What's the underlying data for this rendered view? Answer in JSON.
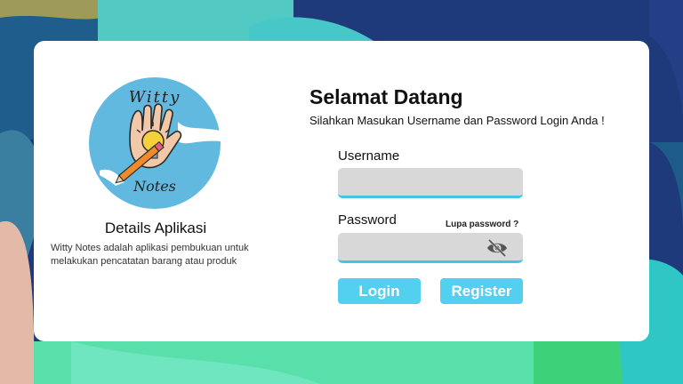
{
  "app": {
    "logo_icon": "witty-notes-hand-pencil-bulb-logo",
    "logo_text_top": "Witty",
    "logo_text_bottom": "Notes"
  },
  "details": {
    "title": "Details Aplikasi",
    "description": "Witty Notes adalah aplikasi pembukuan untuk melakukan pencatatan barang atau produk"
  },
  "login": {
    "title": "Selamat Datang",
    "subtitle": "Silahkan Masukan Username dan Password Login Anda !",
    "username_label": "Username",
    "username_value": "",
    "password_label": "Password",
    "password_value": "",
    "forgot_password": "Lupa password ?",
    "toggle_icon": "eye-off-icon",
    "login_button": "Login",
    "register_button": "Register"
  },
  "colors": {
    "accent": "#53d0f0",
    "input_bg": "#d8d8d8",
    "input_underline": "#45c4e6",
    "logo_circle": "#62b9e0"
  }
}
